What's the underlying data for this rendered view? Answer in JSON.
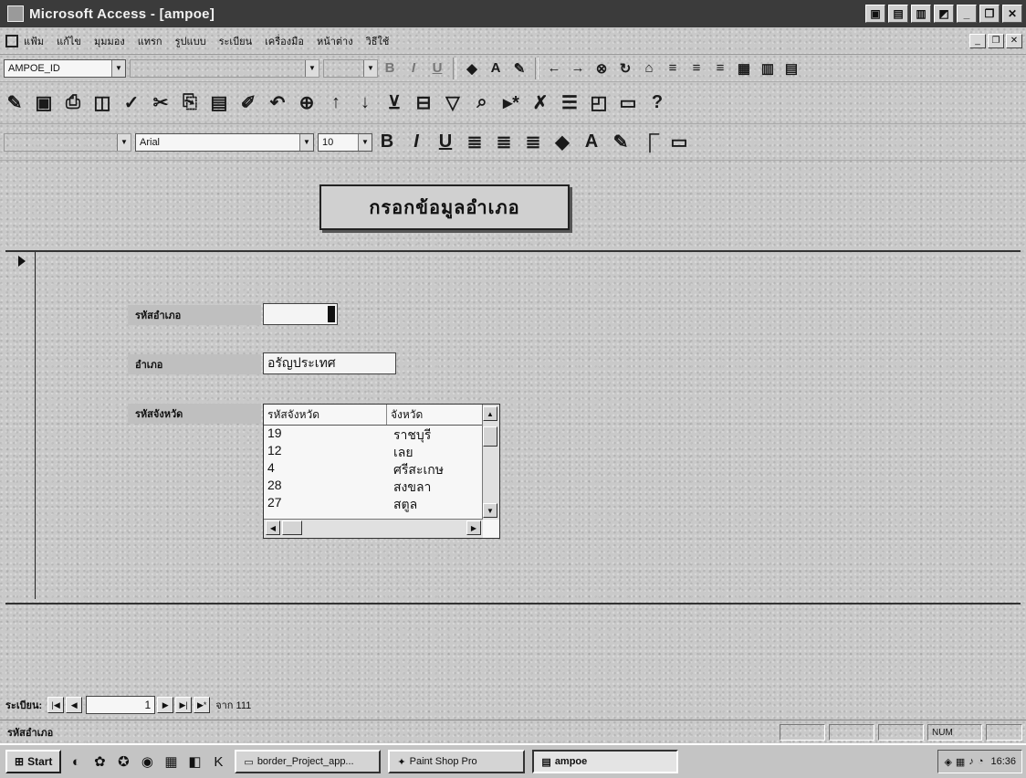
{
  "window": {
    "title": "Microsoft Access - [ampoe]",
    "controls": [
      "▣",
      "▤",
      "▥",
      "◩",
      "_",
      "❐",
      "✕"
    ]
  },
  "menu": {
    "items": [
      "แฟ้ม",
      "แก้ไข",
      "มุมมอง",
      "แทรก",
      "รูปแบบ",
      "ระเบียน",
      "เครื่องมือ",
      "หน้าต่าง",
      "วิธีใช้"
    ],
    "inner_controls": [
      "_",
      "❐",
      "✕"
    ]
  },
  "toolbar_formatting_form": {
    "object_combo": "AMPOE_ID",
    "font_combo": "",
    "size_combo": ""
  },
  "toolbar_form_view": {
    "icons": [
      "view-icon",
      "save-icon",
      "print-icon",
      "print-preview-icon",
      "spelling-icon",
      "cut-icon",
      "copy-icon",
      "paste-icon",
      "format-painter-icon",
      "undo-icon",
      "hyperlink-icon",
      "sort-ascending-icon",
      "sort-descending-icon",
      "filter-by-selection-icon",
      "filter-by-form-icon",
      "apply-filter-icon",
      "find-icon",
      "new-record-icon",
      "delete-record-icon",
      "properties-icon",
      "database-window-icon",
      "new-object-icon",
      "help-icon"
    ]
  },
  "toolbar_formatting": {
    "font": "Arial",
    "size": "10"
  },
  "form": {
    "header_title": "กรอกข้อมูลอำเภอ",
    "fields": {
      "ampoe_id_label": "รหัสอำเภอ",
      "ampoe_id_value": "",
      "ampoe_name_label": "อำเภอ",
      "ampoe_name_value": "อรัญประเทศ",
      "province_label": "รหัสจังหวัด"
    },
    "province_list": {
      "headers": [
        "รหัสจังหวัด",
        "จังหวัด"
      ],
      "rows": [
        [
          "19",
          "ราชบุรี"
        ],
        [
          "12",
          "เลย"
        ],
        [
          "4",
          "ศรีสะเกษ"
        ],
        [
          "28",
          "สงขลา"
        ],
        [
          "27",
          "สตูล"
        ]
      ]
    }
  },
  "navigation": {
    "label": "ระเบียน:",
    "current_record": "1",
    "of_text": "จาก 111"
  },
  "status_bar": {
    "text": "รหัสอำเภอ",
    "num_indicator": "NUM"
  },
  "taskbar": {
    "start_label": "Start",
    "tasks": [
      "border_Project_app...",
      "Paint Shop Pro",
      "ampoe"
    ],
    "clock": "16:36"
  }
}
